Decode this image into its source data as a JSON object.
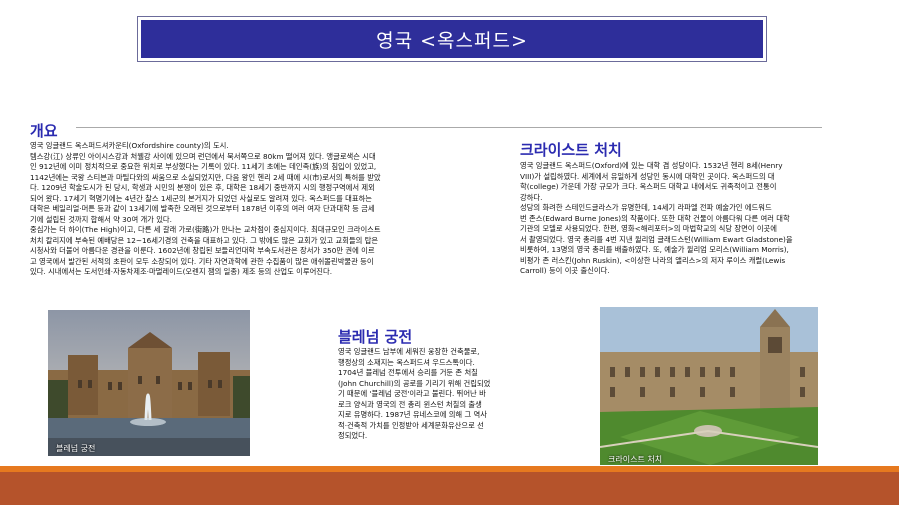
{
  "title": "영국 <옥스퍼드>",
  "overview": {
    "heading": "개요",
    "body": "영국 잉글랜드 옥스퍼드셔카운티(Oxfordshire county)의 도시.\n템스강(江) 상류인 아이시스강과 처웰강 사이에 있으며 런던에서 북서쪽으로 80km 떨어져 있다. 앵글로색슨 시대\n인 912년에 이미 정치적으로 중요한 위치로 부상했다는 기록이 있다. 11세기 초에는 데인족(族)의 침입이 있었고,\n1142년에는 국왕 스티븐과 마틸다와의 싸움으로 소실되었지만, 다음 왕인 헨리 2세 때에 시(市)로서의 특허를 받았\n다. 1209년 학술도시가 된 당시, 학생과 시민의 분쟁이 있은 후, 대학은 18세기 중반까지 시의 행정구역에서 제외\n되어 왔다. 17세기 혁명기에는 4년간 찰스 1세군의 본거지가 되었던 사실로도 알려져 있다. 옥스퍼드를 대표하는\n대학은 베일리얼·머튼 등과 같이 13세기에 발족한 오래된 것으로부터 1878년 이후의 여러 여자 단과대학 등 금세\n기에 설립된 것까지 합해서 약 30여 개가 있다.\n중심가는 더 하이(The High)이고, 다른 세 갈래 가로(街路)가 만나는 교차점이 중심지이다. 최대규모인 크라이스트\n처치 칼리지에 부속된 예배당은 12~16세기경의 건축을 대표하고 있다. 그 밖에도 많은 교회가 있고 교회들의 탑은\n시청사와 더불어 아름다운 경관을 이룬다. 1602년에 창립된 보들리언대학 부속도서관은 장서가 350만 권에 이르\n고 영국에서 발간된 서적의 초판이 모두 소장되어 있다. 기타 자연과학에 관한 수집품이 많은 애쉬몰린박물관 등이\n있다. 시내에서는 도서인쇄·자동차제조·마멀레이드(오렌지 잼의 일종) 제조 등의 산업도 이루어진다."
  },
  "christchurch": {
    "heading": "크라이스트 처치",
    "body": "영국 잉글랜드 옥스퍼드(Oxford)에 있는 대학 겸 성당이다. 1532년 헨리 8세(Henry\nVIII)가 설립하였다. 세계에서 유일하게 성당인 동시에 대학인 곳이다. 옥스퍼드의 대\n학(college) 가운데 가장 규모가 크다. 옥스퍼드 대학교 내에서도 귀족적이고 전통이\n강하다.\n성당의 화려한 스테인드글라스가 유명한데, 14세기 라파엘 전파 예술가인 에드워드\n번 존스(Edward Burne Jones)의 작품이다. 또한 대학 건물이 아름다워 다른 여러 대학\n기관의 모델로 사용되었다. 한편, 영화<해리포터>의 마법학교의 식당 장면이 이곳에\n서 촬영되었다. 영국 총리를 4번 지낸 윌리엄 글래드스턴(William Ewart Gladstone)을\n비롯하여, 13명의 영국 총리를 배출하였다. 또, 예술가 윌리엄 모리스(William Morris),\n비평가 존 러스킨(John Ruskin), <이상한 나라의 앨리스>의 저자 루이스 캐럴(Lewis\nCarroll) 등이 이곳 출신이다."
  },
  "blenheim": {
    "heading": "블레넘 궁전",
    "body": "영국 잉글랜드 남부에 세워진 웅장한 건축물로,\n행정상의 소재지는 옥스퍼드셔 우드스톡이다.\n1704년 블레넘 전투에서 승리를 거둔 존 처칠\n(John Churchill)의 공로를 기리기 위해 건립되었\n기 때문에 '블레넘 궁전'이라고 불린다. 뛰어난 바\n로크 양식과 영국의 전 총리 윈스턴 처칠의 출생\n지로 유명하다. 1987년 유네스코에 의해 그 역사\n적·건축적 가치를 인정받아 세계문화유산으로 선\n정되었다."
  },
  "captions": {
    "left": "블레넘 궁전",
    "right": "크라이스트 처치"
  },
  "colors": {
    "title_bg": "#2e2e9a",
    "heading": "#2b2bb0",
    "stripe_orange": "#e6791f",
    "stripe_brick": "#b5532b"
  }
}
